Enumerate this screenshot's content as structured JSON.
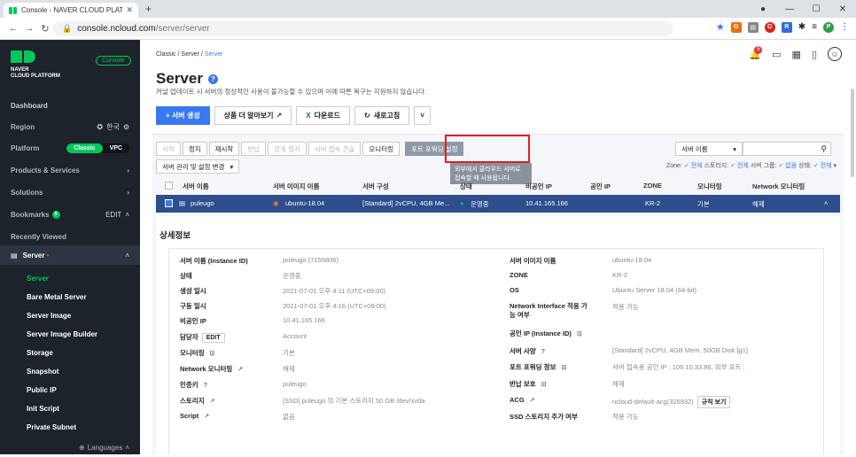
{
  "browser": {
    "tab_title": "Console - NAVER CLOUD PLATF",
    "url_host": "console.ncloud.com",
    "url_path": "/server/server"
  },
  "sidebar": {
    "brand_line1": "NAVER",
    "brand_line2": "CLOUD PLATFORM",
    "console_badge": "Console",
    "dashboard": "Dashboard",
    "region": "Region",
    "region_value": "한국",
    "platform": "Platform",
    "platform_classic": "Classic",
    "platform_vpc": "VPC",
    "products": "Products & Services",
    "solutions": "Solutions",
    "bookmarks": "Bookmarks",
    "bookmarks_count": "0",
    "bookmarks_edit": "EDIT",
    "recently_viewed": "Recently Viewed",
    "server_group": "Server",
    "items": [
      "Server",
      "Bare Metal Server",
      "Server Image",
      "Server Image Builder",
      "Storage",
      "Snapshot",
      "Public IP",
      "Init Script",
      "Private Subnet"
    ],
    "languages": "Languages"
  },
  "header": {
    "breadcrumb_1": "Classic",
    "breadcrumb_2": "Server",
    "breadcrumb_3": "Server",
    "notif_count": "5",
    "title": "Server",
    "desc": "커널 업데이트 시 서버의 정상적인 사용이 불가능할 수 있으며 이에 따른 복구는 지원하지 않습니다."
  },
  "actions": {
    "create": "+ 서버 생성",
    "more_info": "상품 더 알아보기",
    "download": "다운로드",
    "refresh": "새로고침"
  },
  "toolbar": {
    "start": "시작",
    "stop": "정지",
    "restart": "재시작",
    "return": "반납",
    "force_stop": "강제 정지",
    "access_console": "서버 접속 콘솔",
    "monitoring": "모니터링",
    "port_forwarding": "포트 포워딩 설정",
    "manage": "서버 관리 및 설정 변경",
    "tooltip": "외부에서 클라우드 서버로 접속할 때 사용됩니다.",
    "search_select": "서버 이름",
    "filter_zone": "Zone:",
    "filter_all": "전체",
    "filter_storage": "스토리지:",
    "filter_group": "서버 그룹:",
    "filter_none": "없음",
    "filter_status": "상태:"
  },
  "table": {
    "headers": [
      "서버 이름",
      "서버 이미지 이름",
      "서버 구성",
      "상태",
      "비공인 IP",
      "공인 IP",
      "ZONE",
      "모니터링",
      "Network 모니터링"
    ],
    "row": {
      "name": "puleugo",
      "image": "ubuntu-18.04",
      "spec": "[Standard] 2vCPU, 4GB Me...",
      "status": "운영중",
      "private_ip": "10.41.165.166",
      "public_ip": "",
      "zone": "KR-2",
      "monitoring": "기본",
      "net_monitoring": "해제"
    }
  },
  "detail": {
    "heading": "상세정보",
    "left": [
      [
        "서버 이름 (Instance ID)",
        "puleugo (7155806)"
      ],
      [
        "상태",
        "운영중"
      ],
      [
        "생성 일시",
        "2021-07-01 오후 4:11 (UTC+09:00)"
      ],
      [
        "구동 일시",
        "2021-07-01 오후 4:16 (UTC+09:00)"
      ],
      [
        "비공인 IP",
        "10.41.165.166"
      ],
      [
        "담당자",
        "Account"
      ],
      [
        "모니터링",
        "기본"
      ],
      [
        "Network 모니터링",
        "해제"
      ],
      [
        "인증키",
        "puleugo"
      ],
      [
        "스토리지",
        "[SSD] puleugo 의 기본 스토리지  50 GB /dev/xvda"
      ],
      [
        "Script",
        "없음"
      ]
    ],
    "right": [
      [
        "서버 이미지 이름",
        "ubuntu-18.04"
      ],
      [
        "ZONE",
        "KR-2"
      ],
      [
        "OS",
        "Ubuntu Server 18.04 (64-bit)"
      ],
      [
        "Network Interface 적용 가능 여부",
        "적용 가능"
      ],
      [
        "공인 IP (Instance ID)",
        ""
      ],
      [
        "서버 사양",
        "[Standard] 2vCPU, 4GB Mem, 50GB Disk [g1]"
      ],
      [
        "포트 포워딩 정보",
        "서버 접속용 공인 IP : 106.10.33.86, 외부 포트 :"
      ],
      [
        "반납 보호",
        "해제"
      ],
      [
        "ACG",
        "ncloud-default-acg(326932)"
      ],
      [
        "SSD 스토리지 추가 여부",
        "적용 가능"
      ]
    ],
    "edit": "EDIT",
    "acg_rule": "규칙 보기"
  }
}
